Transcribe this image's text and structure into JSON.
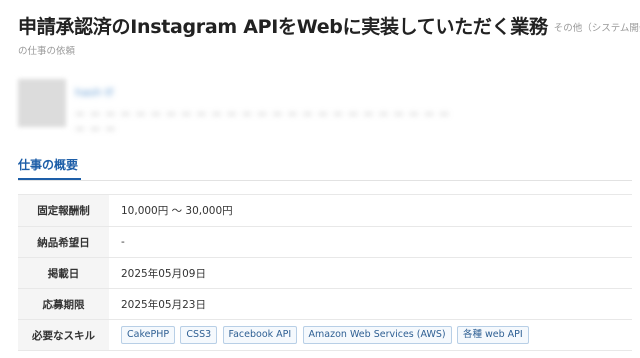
{
  "job": {
    "title": "申請承認済のInstagram APIをWebに実装していただく業務",
    "category_part1": "その他（システム開発）",
    "category_part2": "の仕事の依頼"
  },
  "client": {
    "name": "hash tf",
    "meta": "ー ー ー ー ー  ー ー ー ー ー ー  ー ー ー ー ー ー ー ー  ー ー ー ー ー ー ー ー ー"
  },
  "tabs": [
    {
      "label": "仕事の概要"
    }
  ],
  "details": [
    {
      "label": "固定報酬制",
      "value": "10,000円 ～ 30,000円"
    },
    {
      "label": "納品希望日",
      "value": "-"
    },
    {
      "label": "掲載日",
      "value": "2025年05月09日"
    },
    {
      "label": "応募期限",
      "value": "2025年05月23日"
    },
    {
      "label": "必要なスキル"
    }
  ],
  "skills": [
    "CakePHP",
    "CSS3",
    "Facebook API",
    "Amazon Web Services (AWS)",
    "各種 web API"
  ]
}
